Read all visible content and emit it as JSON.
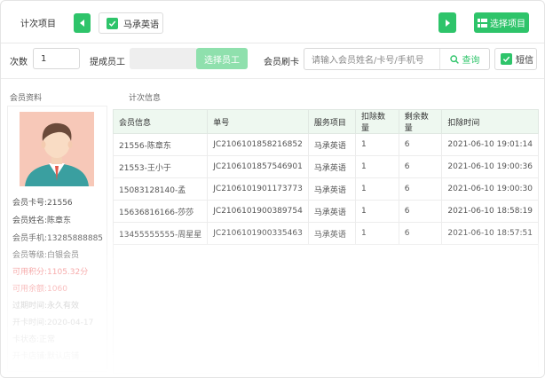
{
  "topbar": {
    "count_item_label": "计次项目",
    "selected_item": "马承英语",
    "select_item_button": "选择项目"
  },
  "row2": {
    "count_label": "次数",
    "count_value": "1",
    "staff_label": "提成员工",
    "select_staff_button": "选择员工",
    "member_card_label": "会员刷卡",
    "search_placeholder": "请输入会员姓名/卡号/手机号",
    "query_button": "查询",
    "sms_label": "短信"
  },
  "left": {
    "section_title": "会员资料",
    "info": [
      "会员卡号:21556",
      "会员姓名:陈章东",
      "会员手机:13285888885",
      "会员等级:白银会员",
      "可用积分:1105.32分",
      "可用余额:1060",
      "过期时间:永久有效",
      "开卡时间:2020-04-17",
      "卡状态:正常",
      "开卡店铺:默认店铺"
    ]
  },
  "table": {
    "section_title": "计次信息",
    "headers": [
      "会员信息",
      "单号",
      "服务项目",
      "扣除数量",
      "剩余数量",
      "扣除时间"
    ],
    "rows": [
      [
        "21556-陈章东",
        "JC2106101858216852",
        "马承英语",
        "1",
        "6",
        "2021-06-10  19:01:14"
      ],
      [
        "21553-王小于",
        "JC2106101857546901",
        "马承英语",
        "1",
        "6",
        "2021-06-10  19:00:36"
      ],
      [
        "15083128140-孟",
        "JC2106101901173773",
        "马承英语",
        "1",
        "6",
        "2021-06-10  19:00:30"
      ],
      [
        "15636816166-莎莎",
        "JC2106101900389754",
        "马承英语",
        "1",
        "6",
        "2021-06-10  18:58:19"
      ],
      [
        "13455555555-周星星",
        "JC2106101900335463",
        "马承英语",
        "1",
        "6",
        "2021-06-10  18:57:51"
      ]
    ]
  },
  "colors": {
    "accent": "#2ec46a",
    "accent_light": "#8fe0ad",
    "warn": "#f06b6b"
  }
}
